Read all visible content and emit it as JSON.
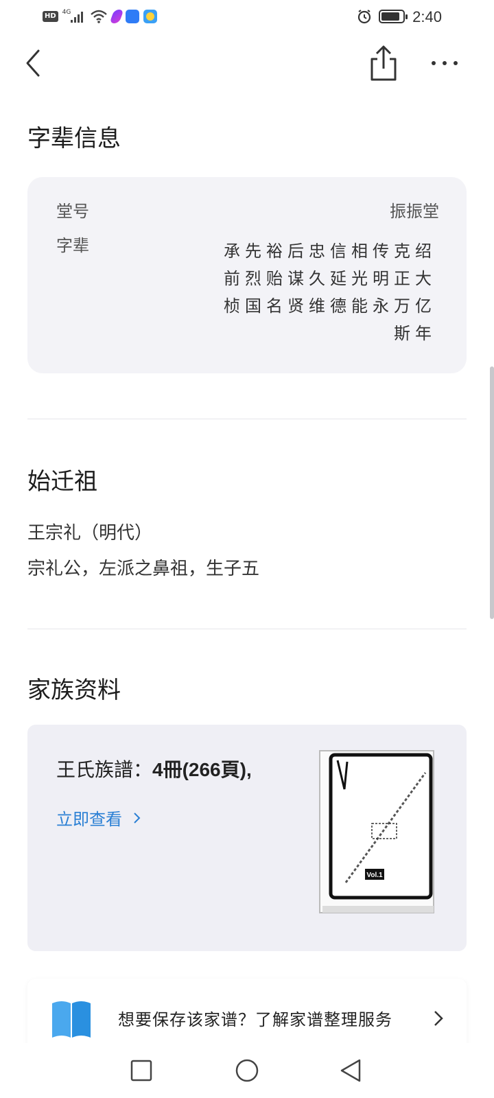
{
  "status_bar": {
    "network_label": "4G",
    "hd_label": "HD",
    "time": "2:40",
    "icons": [
      "hd-icon",
      "signal-icon",
      "wifi-icon",
      "app-icon",
      "cloud-icon",
      "weather-icon",
      "alarm-icon",
      "battery-icon"
    ]
  },
  "top_bar": {
    "icons": [
      "back-arrow-icon",
      "share-icon",
      "more-icon"
    ]
  },
  "zibei_section": {
    "title": "字辈信息",
    "hall_label": "堂号",
    "hall_value": "振振堂",
    "generations_label": "字辈",
    "generations_lines": [
      "承先裕后忠信相传克绍",
      "前烈贻谋久延光明正大",
      "桢国名贤维德能永万亿",
      "斯年"
    ]
  },
  "ancestor_section": {
    "title": "始迁祖",
    "name_line": "王宗礼（明代）",
    "description": "宗礼公，左派之鼻祖，生子五"
  },
  "family_section": {
    "title": "家族资料",
    "book_name": "王氏族譜：",
    "book_detail": "4冊(266頁),",
    "view_link": "立即查看",
    "cover_label": "Vol.1"
  },
  "promo": {
    "text": "想要保存该家谱？了解家谱整理服务",
    "icon": "book-icon"
  },
  "nav_bar": {
    "icons": [
      "recent-apps-icon",
      "home-icon",
      "back-icon"
    ]
  },
  "colors": {
    "accent": "#2a7fd4",
    "card_bg": "#f3f3f7",
    "family_card_bg": "#efeff5",
    "text_primary": "#1c1c1c",
    "text_secondary": "#555555"
  }
}
